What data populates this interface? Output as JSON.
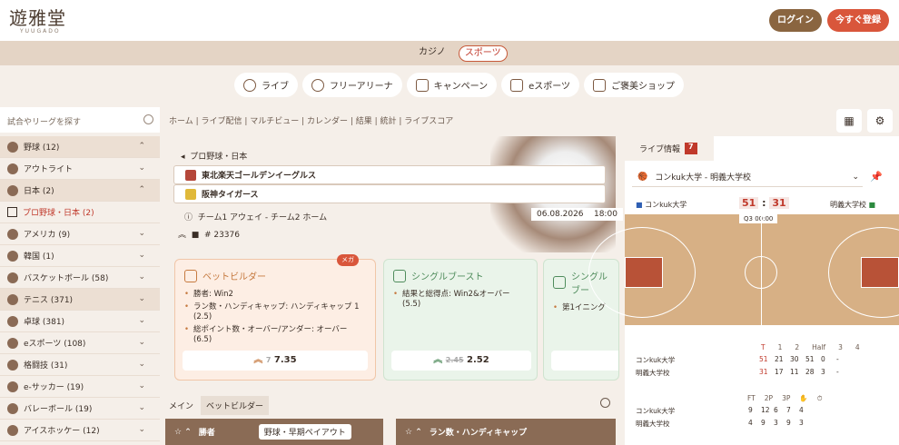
{
  "brand": {
    "kanji": "遊雅堂",
    "roman": "YUUGADO"
  },
  "header": {
    "login": "ログイン",
    "register": "今すぐ登録"
  },
  "topTabs": [
    "カジノ",
    "スポーツ"
  ],
  "pills": [
    "ライブ",
    "フリーアリーナ",
    "キャンペーン",
    "eスポーツ",
    "ご褒美ショップ"
  ],
  "search": {
    "placeholder": "試合やリーグを探す"
  },
  "sidebar": [
    {
      "label": "野球 (12)",
      "chev": "⌃"
    },
    {
      "label": "アウトライト",
      "chev": "⌄"
    },
    {
      "label": "日本 (2)",
      "chev": "⌃"
    },
    {
      "label": "プロ野球・日本 (2)",
      "chev": ""
    },
    {
      "label": "アメリカ (9)",
      "chev": "⌄"
    },
    {
      "label": "韓国 (1)",
      "chev": "⌄"
    },
    {
      "label": "バスケットボール (58)",
      "chev": "⌄"
    },
    {
      "label": "テニス (371)",
      "chev": "⌄"
    },
    {
      "label": "卓球 (381)",
      "chev": "⌄"
    },
    {
      "label": "eスポーツ (108)",
      "chev": "⌄"
    },
    {
      "label": "格闘技 (31)",
      "chev": "⌄"
    },
    {
      "label": "e-サッカー (19)",
      "chev": "⌄"
    },
    {
      "label": "バレーボール (19)",
      "chev": "⌄"
    },
    {
      "label": "アイスホッケー (12)",
      "chev": "⌄"
    }
  ],
  "breadcrumb": "ホーム | ライブ配信 | マルチビュー | カレンダー | 結果 | 統計 | ライブスコア",
  "event": {
    "league": "プロ野球・日本",
    "team1": "東北楽天ゴールデンイーグルス",
    "team2": "阪神タイガース",
    "info": "チーム1 アウェイ - チーム2 ホーム",
    "id": "# 23376",
    "date": "06.08.2026",
    "time": "18:00"
  },
  "cards": [
    {
      "title": "ベットビルダー",
      "items": [
        "勝者: Win2",
        "ラン数・ハンディキャップ: ハンディキャップ 1 (2.5)",
        "総ポイント数・オーバー/アンダー: オーバー (6.5)"
      ],
      "odd_old": "7",
      "odd": "7.35"
    },
    {
      "title": "シングルブースト",
      "items": [
        "結果と総得点: Win2&オーバー (5.5)"
      ],
      "odd_old": "2.45",
      "odd": "2.52"
    },
    {
      "title": "シングルブー",
      "items": [
        "第1イニング"
      ],
      "odd_old": "",
      "odd": ""
    }
  ],
  "mega": "メガ",
  "marketTabs": [
    "メイン",
    "ベットビルダー"
  ],
  "markets": [
    {
      "title": "勝者",
      "chip": "野球・早期ペイアウト"
    },
    {
      "title": "ラン数・ハンディキャップ",
      "chip": ""
    }
  ],
  "live": {
    "tab": "ライブ情報",
    "count": "7",
    "match": "コンkuk大学 - 明義大学校",
    "home": "コンkuk大学",
    "away": "明義大学校",
    "s1": "51",
    "s2": "31",
    "quarter": "Q3 00:00",
    "hdr": [
      "T",
      "1",
      "2",
      "Half",
      "3",
      "4"
    ],
    "rows": [
      [
        "コンkuk大学",
        "51",
        "21",
        "30",
        "51",
        "0",
        "-"
      ],
      [
        "明義大学校",
        "31",
        "17",
        "11",
        "28",
        "3",
        "-"
      ]
    ],
    "hdr2": [
      "FT",
      "2P",
      "3P"
    ],
    "rows2": [
      [
        "コンkuk大学",
        "9",
        "12",
        "6",
        "7",
        "4"
      ],
      [
        "明義大学校",
        "4",
        "9",
        "3",
        "9",
        "3"
      ]
    ]
  }
}
